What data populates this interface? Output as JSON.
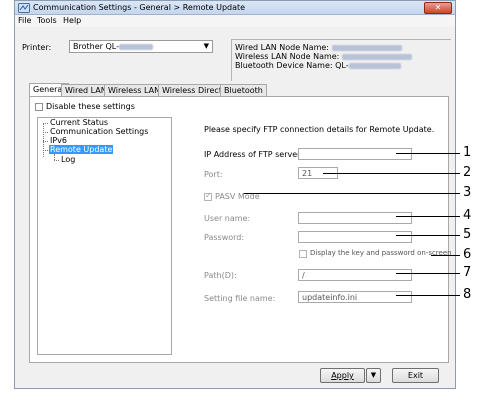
{
  "window": {
    "title": "Communication Settings - General > Remote Update",
    "close_symbol": "✕"
  },
  "menu": [
    "File",
    "Tools",
    "Help"
  ],
  "printer": {
    "label": "Printer:",
    "selected_value": "Brother QL-",
    "arrow": "▼"
  },
  "node_info": {
    "wired_lan_label": "Wired LAN Node Name:",
    "wireless_lan_label": "Wireless LAN Node Name:",
    "bluetooth_label": "Bluetooth Device Name: QL-"
  },
  "tabs": [
    {
      "label": "General",
      "active": true
    },
    {
      "label": "Wired LAN",
      "active": false
    },
    {
      "label": "Wireless LAN",
      "active": false
    },
    {
      "label": "Wireless Direct",
      "active": false
    },
    {
      "label": "Bluetooth",
      "active": false
    }
  ],
  "disable_settings": {
    "label": "Disable these settings",
    "checked": false
  },
  "tree": {
    "items": [
      "Current Status",
      "Communication Settings",
      "IPv6",
      "Remote Update",
      "Log"
    ],
    "selected": "Remote Update"
  },
  "form": {
    "instructions": "Please specify FTP connection details for Remote Update.",
    "ftp_ip_label": "IP Address of FTP server:",
    "ftp_ip_value": "",
    "port_label": "Port:",
    "port_value": "21",
    "pasv_label": "PASV Mode",
    "pasv_checked": true,
    "username_label": "User name:",
    "username_value": "",
    "password_label": "Password:",
    "password_value": "",
    "display_key_label": "Display the key and password on-screen",
    "display_key_checked": false,
    "path_label": "Path(D):",
    "path_value": "/",
    "setting_file_label": "Setting file name:",
    "setting_file_value": "updateinfo.ini"
  },
  "buttons": {
    "apply_label": "Apply",
    "apply_arrow": "▼",
    "exit_label": "Exit"
  },
  "callouts": [
    "1",
    "2",
    "3",
    "4",
    "5",
    "6",
    "7",
    "8"
  ]
}
